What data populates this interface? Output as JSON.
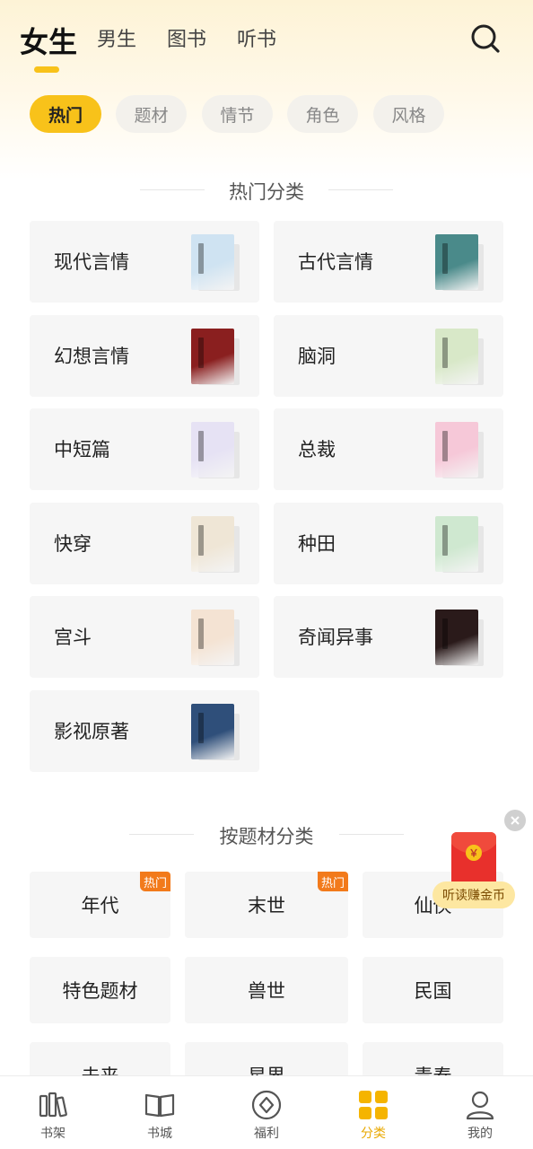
{
  "header": {
    "tabs": [
      {
        "label": "女生",
        "active": true
      },
      {
        "label": "男生",
        "active": false
      },
      {
        "label": "图书",
        "active": false
      },
      {
        "label": "听书",
        "active": false
      }
    ],
    "search_icon": "search-icon"
  },
  "filters": [
    {
      "label": "热门",
      "active": true
    },
    {
      "label": "题材",
      "active": false
    },
    {
      "label": "情节",
      "active": false
    },
    {
      "label": "角色",
      "active": false
    },
    {
      "label": "风格",
      "active": false
    }
  ],
  "hot_section": {
    "title": "热门分类",
    "items": [
      {
        "label": "现代言情",
        "cover_color": "#cfe3f2"
      },
      {
        "label": "古代言情",
        "cover_color": "#4a8a8a"
      },
      {
        "label": "幻想言情",
        "cover_color": "#8a1f1f"
      },
      {
        "label": "脑洞",
        "cover_color": "#d8e8c8"
      },
      {
        "label": "中短篇",
        "cover_color": "#e6e2f4"
      },
      {
        "label": "总裁",
        "cover_color": "#f6c8d8"
      },
      {
        "label": "快穿",
        "cover_color": "#efe6d6"
      },
      {
        "label": "种田",
        "cover_color": "#cfe8d0"
      },
      {
        "label": "宫斗",
        "cover_color": "#f4e3d3"
      },
      {
        "label": "奇闻异事",
        "cover_color": "#2a1a1a"
      },
      {
        "label": "影视原著",
        "cover_color": "#2f4f7a"
      }
    ]
  },
  "subject_section": {
    "title": "按题材分类",
    "items": [
      {
        "label": "年代",
        "badge": "热门"
      },
      {
        "label": "末世",
        "badge": "热门"
      },
      {
        "label": "仙侠",
        "badge": ""
      },
      {
        "label": "特色题材",
        "badge": ""
      },
      {
        "label": "兽世",
        "badge": ""
      },
      {
        "label": "民国",
        "badge": ""
      },
      {
        "label": "未来",
        "badge": ""
      },
      {
        "label": "星界",
        "badge": ""
      },
      {
        "label": "青春",
        "badge": ""
      }
    ]
  },
  "floating_promo": {
    "label": "听读赚金币",
    "icon": "red-packet-icon"
  },
  "bottom_nav": [
    {
      "label": "书架",
      "icon": "bookshelf-icon",
      "active": false
    },
    {
      "label": "书城",
      "icon": "book-store-icon",
      "active": false
    },
    {
      "label": "福利",
      "icon": "welfare-icon",
      "active": false
    },
    {
      "label": "分类",
      "icon": "category-icon",
      "active": true
    },
    {
      "label": "我的",
      "icon": "profile-icon",
      "active": false
    }
  ],
  "colors": {
    "accent": "#f8c21a",
    "hot_badge": "#f27a1b",
    "red_packet": "#e8302c"
  }
}
